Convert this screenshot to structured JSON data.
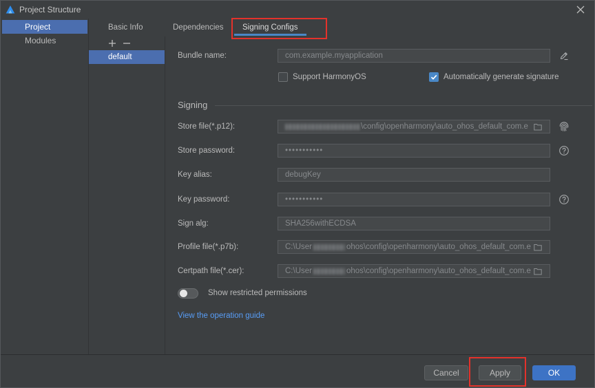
{
  "window": {
    "title": "Project Structure",
    "logo_icon": "deveco-logo-icon",
    "close_icon": "close-icon"
  },
  "sidebar": {
    "items": [
      {
        "label": "Project",
        "selected": true
      },
      {
        "label": "Modules",
        "selected": false
      }
    ]
  },
  "config_list": {
    "add_icon": "plus-icon",
    "remove_icon": "minus-icon",
    "items": [
      {
        "label": "default",
        "selected": true
      }
    ]
  },
  "tabs": [
    {
      "label": "Basic Info",
      "selected": false
    },
    {
      "label": "Dependencies",
      "selected": false
    },
    {
      "label": "Signing Configs",
      "selected": true
    }
  ],
  "form": {
    "bundle_name": {
      "label": "Bundle name:",
      "value": "com.example.myapplication",
      "edit_icon": "pencil-icon"
    },
    "support_harmonyos": {
      "label": "Support HarmonyOS",
      "checked": false
    },
    "auto_generate_signature": {
      "label": "Automatically generate signature",
      "checked": true
    },
    "signing": {
      "section_title": "Signing",
      "store_file": {
        "label": "Store file(*.p12):",
        "value_visible": "\\config\\openharmony\\auto_ohos_default_com.e",
        "folder_icon": "folder-icon",
        "side_icon": "fingerprint-icon"
      },
      "store_password": {
        "label": "Store password:",
        "value": "•••••••••••",
        "help_icon": "help-icon"
      },
      "key_alias": {
        "label": "Key alias:",
        "value": "debugKey"
      },
      "key_password": {
        "label": "Key password:",
        "value": "•••••••••••",
        "help_icon": "help-icon"
      },
      "sign_alg": {
        "label": "Sign alg:",
        "value": "SHA256withECDSA"
      },
      "profile_file": {
        "label": "Profile file(*.p7b):",
        "value_start": "C:\\User",
        "value_end": "ohos\\config\\openharmony\\auto_ohos_default_com.e",
        "folder_icon": "folder-icon"
      },
      "certpath_file": {
        "label": "Certpath file(*.cer):",
        "value_start": "C:\\User",
        "value_end": "ohos\\config\\openharmony\\auto_ohos_default_com.e",
        "folder_icon": "folder-icon"
      }
    },
    "show_restricted_permissions": {
      "label": "Show restricted permissions",
      "on": false
    },
    "operation_guide_link": "View the operation guide"
  },
  "footer": {
    "cancel_label": "Cancel",
    "apply_label": "Apply",
    "ok_label": "OK"
  },
  "colors": {
    "background": "#3c3f41",
    "selection": "#4b6eaf",
    "tab_underline": "#4a88c7",
    "checkbox_checked": "#4a88c7",
    "link": "#589df6",
    "primary_button": "#3d73c5",
    "annotation_highlight": "#e4322b"
  }
}
